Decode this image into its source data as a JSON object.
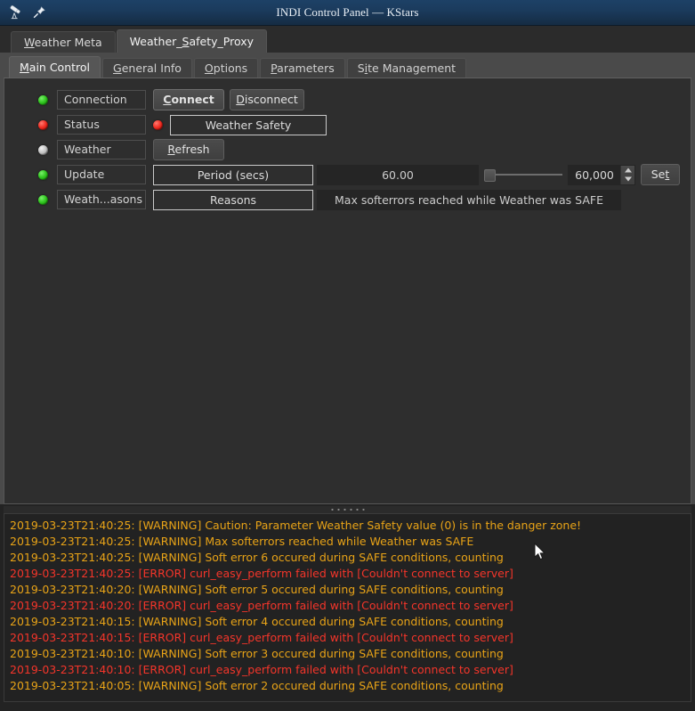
{
  "window": {
    "title": "INDI Control Panel — KStars",
    "icons": [
      {
        "name": "telescope-icon",
        "glyph": "⸮"
      },
      {
        "name": "pin-icon",
        "glyph": "✦"
      }
    ]
  },
  "device_tabs": [
    {
      "label": "Weather Meta",
      "accel_index": 0,
      "selected": false
    },
    {
      "label": "Weather_Safety_Proxy",
      "accel_index": 8,
      "selected": true
    }
  ],
  "property_tabs": [
    {
      "label": "Main Control",
      "accel_index": 0,
      "selected": true
    },
    {
      "label": "General Info",
      "accel_index": 0,
      "selected": false
    },
    {
      "label": "Options",
      "accel_index": 0,
      "selected": false
    },
    {
      "label": "Parameters",
      "accel_index": 0,
      "selected": false
    },
    {
      "label": "Site Management",
      "accel_index": 1,
      "selected": false
    }
  ],
  "properties": [
    {
      "name": "connection",
      "led": "green",
      "label": "Connection",
      "buttons": [
        {
          "label": "Connect",
          "accel_index": 0,
          "focused": true
        },
        {
          "label": "Disconnect",
          "accel_index": 0,
          "focused": false
        }
      ]
    },
    {
      "name": "status",
      "led": "red",
      "label": "Status",
      "inner_led": "red",
      "switch_label": "Weather Safety"
    },
    {
      "name": "weather",
      "led": "grey",
      "label": "Weather",
      "buttons": [
        {
          "label": "Refresh",
          "accel_index": 0,
          "focused": false
        }
      ]
    },
    {
      "name": "update",
      "led": "green",
      "label": "Update",
      "switch_label": "Period (secs)",
      "value": "60.00",
      "slider_position": 0,
      "spin_value": "60,000",
      "set_button": {
        "label": "Set",
        "accel_index": 2
      }
    },
    {
      "name": "weather-reasons",
      "led": "green",
      "label": "Weath...asons",
      "switch_label": "Reasons",
      "value": "Max softerrors reached while Weather was SAFE"
    }
  ],
  "log": {
    "lines": [
      {
        "text": "2019-03-23T21:40:25: [WARNING] Caution: Parameter Weather Safety value (0) is in the danger zone!",
        "level": "warning"
      },
      {
        "text": "2019-03-23T21:40:25: [WARNING] Max softerrors reached while Weather was SAFE",
        "level": "warning"
      },
      {
        "text": "2019-03-23T21:40:25: [WARNING] Soft error 6 occured during SAFE conditions, counting",
        "level": "warning"
      },
      {
        "text": "2019-03-23T21:40:25: [ERROR] curl_easy_perform failed with [Couldn't connect to server]",
        "level": "error"
      },
      {
        "text": "2019-03-23T21:40:20: [WARNING] Soft error 5 occured during SAFE conditions, counting",
        "level": "warning"
      },
      {
        "text": "2019-03-23T21:40:20: [ERROR] curl_easy_perform failed with [Couldn't connect to server]",
        "level": "error"
      },
      {
        "text": "2019-03-23T21:40:15: [WARNING] Soft error 4 occured during SAFE conditions, counting",
        "level": "warning"
      },
      {
        "text": "2019-03-23T21:40:15: [ERROR] curl_easy_perform failed with [Couldn't connect to server]",
        "level": "error"
      },
      {
        "text": "2019-03-23T21:40:10: [WARNING] Soft error 3 occured during SAFE conditions, counting",
        "level": "warning"
      },
      {
        "text": "2019-03-23T21:40:10: [ERROR] curl_easy_perform failed with [Couldn't connect to server]",
        "level": "error"
      },
      {
        "text": "2019-03-23T21:40:05: [WARNING] Soft error 2 occured during SAFE conditions, counting",
        "level": "warning"
      }
    ]
  },
  "colors": {
    "titlebar": "#1b3b5d",
    "window_bg": "#2e2e2e",
    "panel_bg": "#4a4a4a",
    "log_bg": "#222222",
    "warning": "#e8a317",
    "error": "#f4352a",
    "led_green": "#2fc41e",
    "led_red": "#ee2a20",
    "led_grey": "#c3c3c3"
  }
}
